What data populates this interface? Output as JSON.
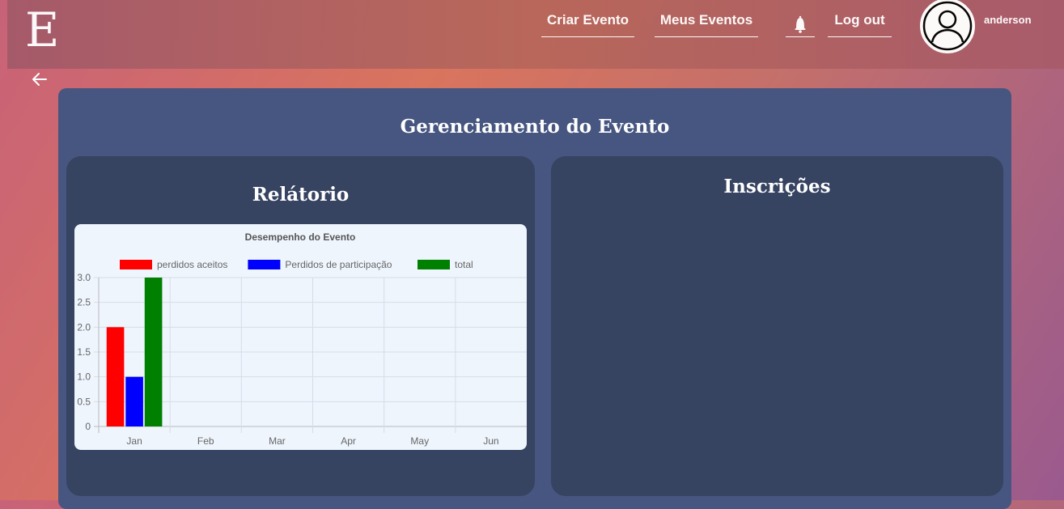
{
  "header": {
    "logo": "E",
    "nav": [
      "Criar Evento",
      "Meus Eventos",
      "Log out"
    ],
    "username": "anderson"
  },
  "main": {
    "title": "Gerenciamento do Evento",
    "report_title": "Relátorio",
    "subscriptions_title": "Inscrições"
  },
  "chart_data": {
    "type": "bar",
    "title": "Desempenho do Evento",
    "categories": [
      "Jan",
      "Feb",
      "Mar",
      "Apr",
      "May",
      "Jun"
    ],
    "series": [
      {
        "name": "perdidos aceitos",
        "color": "#ff0000",
        "values": [
          2,
          0,
          0,
          0,
          0,
          0
        ]
      },
      {
        "name": "Perdidos de participação",
        "color": "#0000ff",
        "values": [
          1,
          0,
          0,
          0,
          0,
          0
        ]
      },
      {
        "name": "total",
        "color": "#008000",
        "values": [
          3,
          0,
          0,
          0,
          0,
          0
        ]
      }
    ],
    "ylim": [
      0,
      3
    ],
    "yticks": [
      "0",
      "0.5",
      "1.0",
      "1.5",
      "2.0",
      "2.5",
      "3.0"
    ],
    "legend_position": "top",
    "grid": true
  }
}
